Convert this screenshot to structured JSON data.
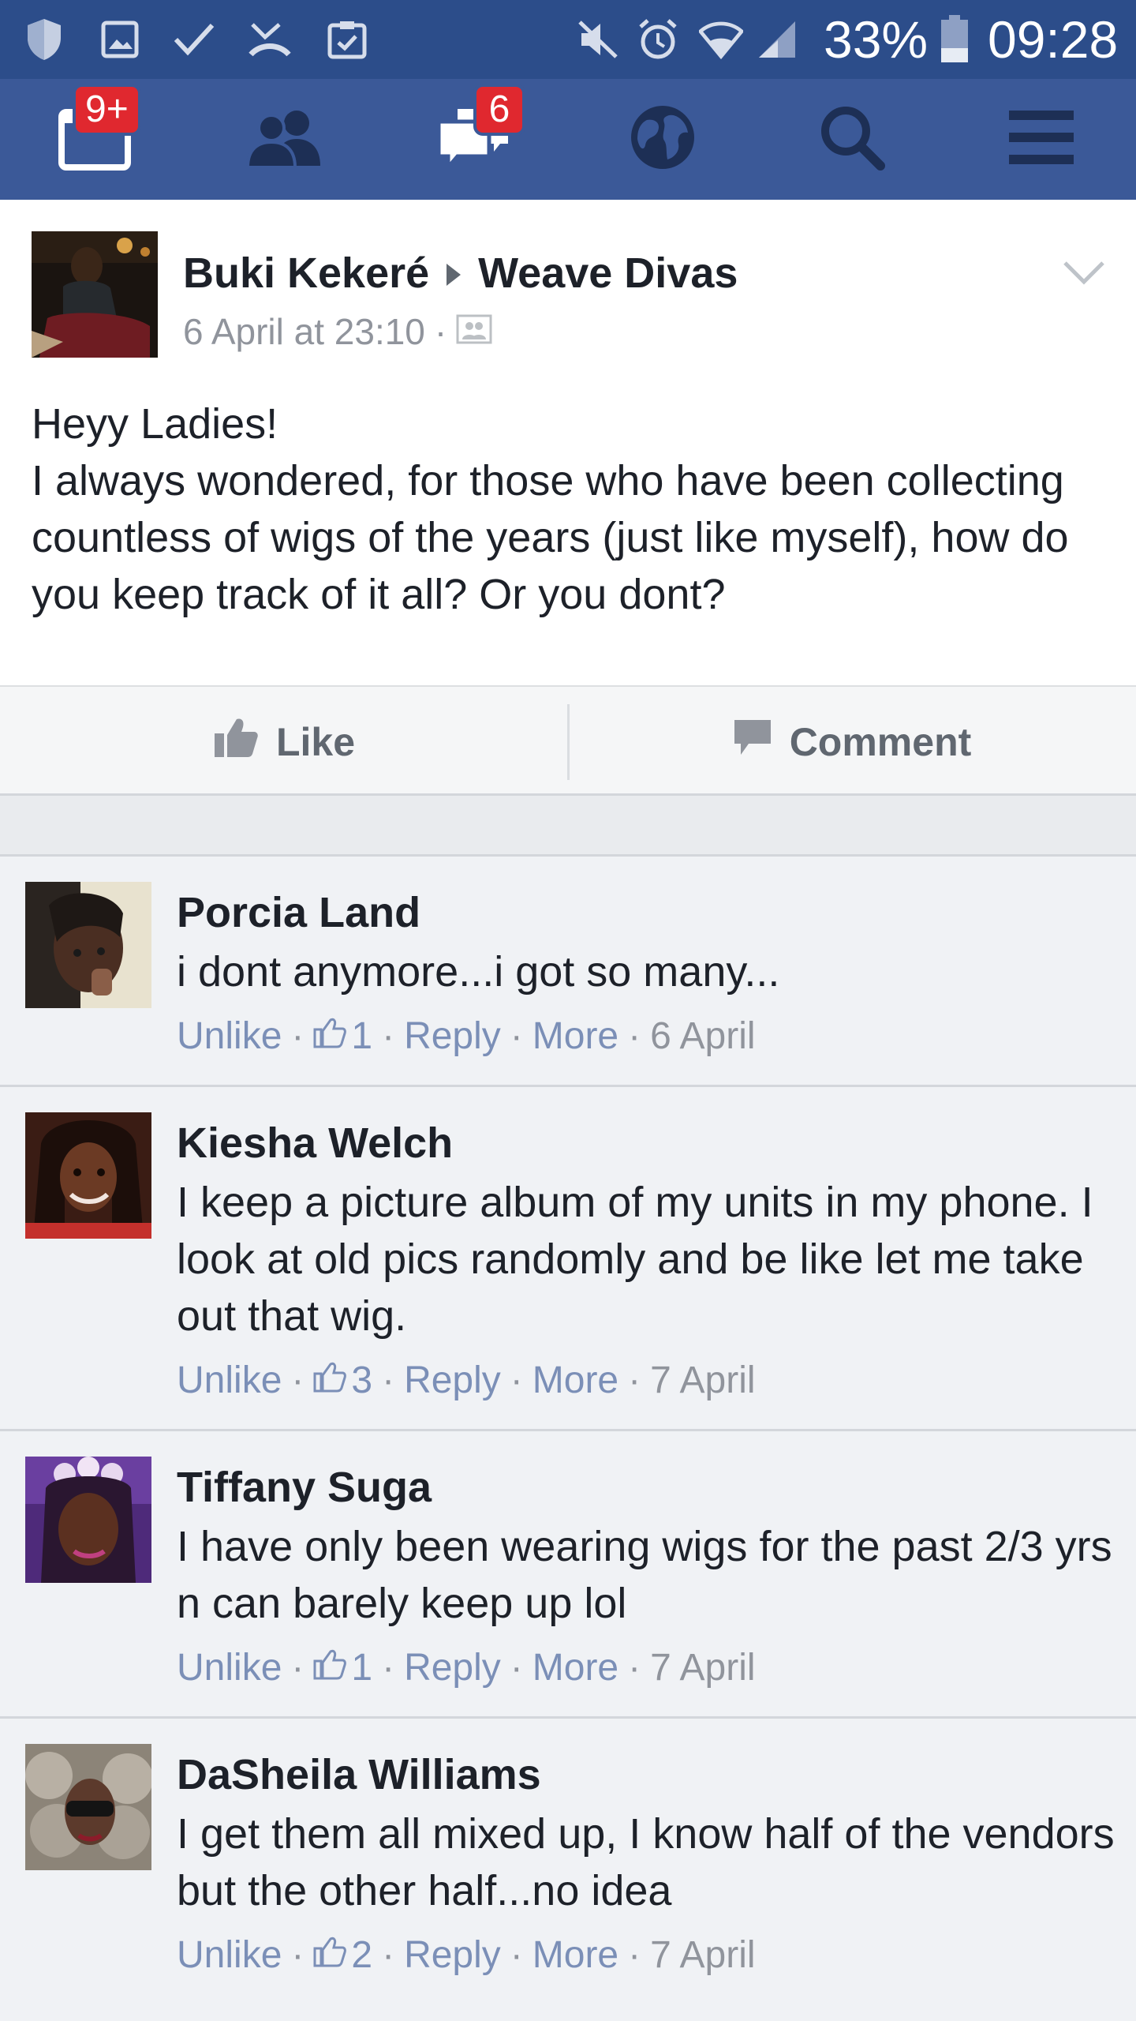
{
  "status_bar": {
    "battery": "33%",
    "time": "09:28",
    "icons": [
      "shield-icon",
      "image-icon",
      "check-icon",
      "missed-call-icon",
      "clipboard-icon",
      "mute-icon",
      "alarm-icon",
      "wifi-icon",
      "signal-icon",
      "battery-icon"
    ]
  },
  "nav": {
    "notifications_badge": "9+",
    "messages_badge": "6",
    "icons": [
      "news-feed-icon",
      "friends-icon",
      "messages-icon",
      "globe-icon",
      "search-icon",
      "menu-icon"
    ]
  },
  "post": {
    "author": "Buki Kekeré",
    "group": "Weave Divas",
    "timestamp": "6 April at 23:10",
    "meta_separator": "·",
    "body": [
      "Heyy Ladies!",
      "I always wondered, for those who have been collecting countless of wigs of the years (just like myself), how do you keep track of it all? Or you dont?"
    ],
    "like_label": "Like",
    "comment_label": "Comment"
  },
  "comments": [
    {
      "name": "Porcia Land",
      "text": "i dont anymore...i got so many...",
      "unlike": "Unlike",
      "likes": "1",
      "reply": "Reply",
      "more": "More",
      "date": "6 April"
    },
    {
      "name": "Kiesha Welch",
      "text": "I keep a picture album of my units in my phone. I look at old pics randomly and be like let me take out that wig.",
      "unlike": "Unlike",
      "likes": "3",
      "reply": "Reply",
      "more": "More",
      "date": "7 April"
    },
    {
      "name": "Tiffany Suga",
      "text": "I have only been wearing wigs for the past 2/3 yrs n can barely keep up lol",
      "unlike": "Unlike",
      "likes": "1",
      "reply": "Reply",
      "more": "More",
      "date": "7 April"
    },
    {
      "name": "DaSheila Williams",
      "text": "I get them all mixed up, I know half of the vendors but the other half...no idea",
      "unlike": "Unlike",
      "likes": "2",
      "reply": "Reply",
      "more": "More",
      "date": "7 April"
    }
  ],
  "colors": {
    "status_bar": "#2c4d8a",
    "nav_bar": "#3b5998",
    "badge": "#e0282f",
    "link": "#7b8fb7",
    "text": "#1d2129",
    "muted": "#90949c"
  }
}
